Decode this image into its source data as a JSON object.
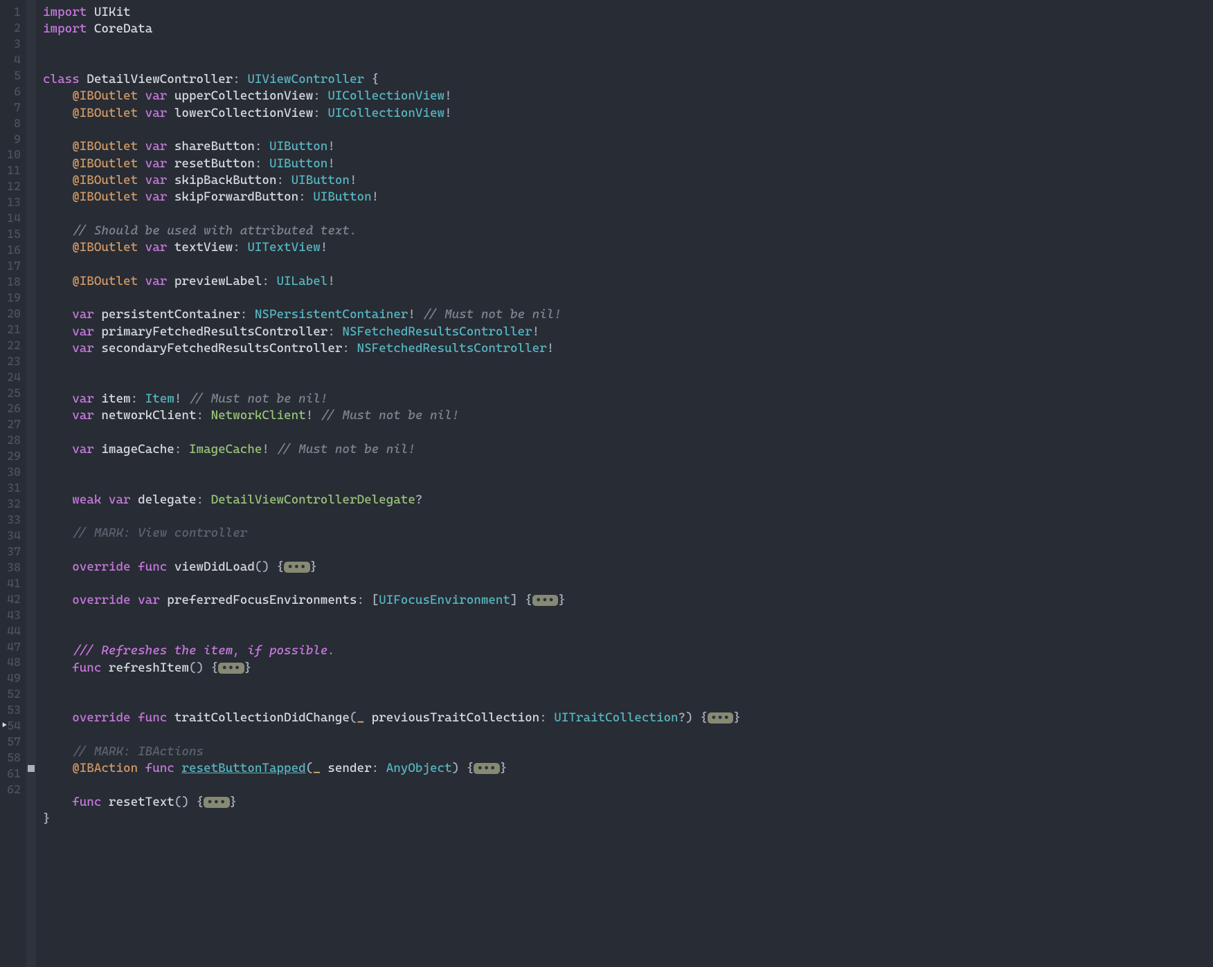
{
  "editor": {
    "lines": [
      {
        "num": "1",
        "html": "<span class='kw'>import</span> <span class='ident'>UIKit</span>"
      },
      {
        "num": "2",
        "html": "<span class='kw'>import</span> <span class='ident'>CoreData</span>"
      },
      {
        "num": "3",
        "html": ""
      },
      {
        "num": "4",
        "html": ""
      },
      {
        "num": "5",
        "html": "<span class='kw'>class</span> <span class='ident'>DetailViewController</span><span class='punc'>:</span> <span class='type'>UIViewController</span> <span class='punc'>{</span>"
      },
      {
        "num": "6",
        "html": "    <span class='attr'>@IBOutlet</span> <span class='kw'>var</span> <span class='ident'>upperCollectionView</span><span class='punc'>:</span> <span class='type'>UICollectionView</span><span class='punc'>!</span>"
      },
      {
        "num": "7",
        "html": "    <span class='attr'>@IBOutlet</span> <span class='kw'>var</span> <span class='ident'>lowerCollectionView</span><span class='punc'>:</span> <span class='type'>UICollectionView</span><span class='punc'>!</span>"
      },
      {
        "num": "8",
        "html": ""
      },
      {
        "num": "9",
        "html": "    <span class='attr'>@IBOutlet</span> <span class='kw'>var</span> <span class='ident'>shareButton</span><span class='punc'>:</span> <span class='type'>UIButton</span><span class='punc'>!</span>"
      },
      {
        "num": "10",
        "html": "    <span class='attr'>@IBOutlet</span> <span class='kw'>var</span> <span class='ident'>resetButton</span><span class='punc'>:</span> <span class='type'>UIButton</span><span class='punc'>!</span>"
      },
      {
        "num": "11",
        "html": "    <span class='attr'>@IBOutlet</span> <span class='kw'>var</span> <span class='ident'>skipBackButton</span><span class='punc'>:</span> <span class='type'>UIButton</span><span class='punc'>!</span>"
      },
      {
        "num": "12",
        "html": "    <span class='attr'>@IBOutlet</span> <span class='kw'>var</span> <span class='ident'>skipForwardButton</span><span class='punc'>:</span> <span class='type'>UIButton</span><span class='punc'>!</span>"
      },
      {
        "num": "13",
        "html": ""
      },
      {
        "num": "14",
        "html": "    <span class='cmt'>// Should be used with attributed text.</span>"
      },
      {
        "num": "15",
        "html": "    <span class='attr'>@IBOutlet</span> <span class='kw'>var</span> <span class='ident'>textView</span><span class='punc'>:</span> <span class='type'>UITextView</span><span class='punc'>!</span>"
      },
      {
        "num": "16",
        "html": ""
      },
      {
        "num": "17",
        "html": "    <span class='attr'>@IBOutlet</span> <span class='kw'>var</span> <span class='ident'>previewLabel</span><span class='punc'>:</span> <span class='type'>UILabel</span><span class='punc'>!</span>"
      },
      {
        "num": "18",
        "html": ""
      },
      {
        "num": "19",
        "html": "    <span class='kw'>var</span> <span class='ident'>persistentContainer</span><span class='punc'>:</span> <span class='type'>NSPersistentContainer</span><span class='punc'>!</span> <span class='cmt'>// Must not be nil!</span>"
      },
      {
        "num": "20",
        "html": "    <span class='kw'>var</span> <span class='ident'>primaryFetchedResultsController</span><span class='punc'>:</span> <span class='type'>NSFetchedResultsController</span><span class='punc'>!</span>"
      },
      {
        "num": "21",
        "html": "    <span class='kw'>var</span> <span class='ident'>secondaryFetchedResultsController</span><span class='punc'>:</span> <span class='type'>NSFetchedResultsController</span><span class='punc'>!</span>"
      },
      {
        "num": "22",
        "html": ""
      },
      {
        "num": "23",
        "html": ""
      },
      {
        "num": "24",
        "html": "    <span class='kw'>var</span> <span class='ident'>item</span><span class='punc'>:</span> <span class='type'>Item</span><span class='punc'>!</span> <span class='cmt'>// Must not be nil!</span>"
      },
      {
        "num": "25",
        "html": "    <span class='kw'>var</span> <span class='ident'>networkClient</span><span class='punc'>:</span> <span class='typeG'>NetworkClient</span><span class='punc'>!</span> <span class='cmt'>// Must not be nil!</span>"
      },
      {
        "num": "26",
        "html": ""
      },
      {
        "num": "27",
        "html": "    <span class='kw'>var</span> <span class='ident'>imageCache</span><span class='punc'>:</span> <span class='typeG'>ImageCache</span><span class='punc'>!</span> <span class='cmt'>// Must not be nil!</span>"
      },
      {
        "num": "28",
        "html": ""
      },
      {
        "num": "29",
        "html": ""
      },
      {
        "num": "30",
        "html": "    <span class='kw'>weak</span> <span class='kw'>var</span> <span class='ident'>delegate</span><span class='punc'>:</span> <span class='typeG'>DetailViewControllerDelegate</span><span class='punc'>?</span>"
      },
      {
        "num": "31",
        "html": ""
      },
      {
        "num": "32",
        "html": "    <span class='cmt2'>// MARK: View controller</span>"
      },
      {
        "num": "33",
        "html": ""
      },
      {
        "num": "34",
        "html": "    <span class='kw'>override</span> <span class='kw'>func</span> <span class='ident'>viewDidLoad</span><span class='punc'>() {</span><span class='fold-chip' data-name='fold-chip-icon' data-interactable='true'>&bull;&bull;&bull;</span><span class='punc'>}</span>"
      },
      {
        "num": "37",
        "html": ""
      },
      {
        "num": "38",
        "html": "    <span class='kw'>override</span> <span class='kw'>var</span> <span class='ident'>preferredFocusEnvironments</span><span class='punc'>: [</span><span class='type'>UIFocusEnvironment</span><span class='punc'>] {</span><span class='fold-chip' data-name='fold-chip-icon' data-interactable='true'>&bull;&bull;&bull;</span><span class='punc'>}</span>"
      },
      {
        "num": "41",
        "html": ""
      },
      {
        "num": "42",
        "html": ""
      },
      {
        "num": "43",
        "html": "    <span class='doc'>/// Refreshes the item, if possible.</span>"
      },
      {
        "num": "44",
        "html": "    <span class='kw'>func</span> <span class='ident'>refreshItem</span><span class='punc'>() {</span><span class='fold-chip' data-name='fold-chip-icon' data-interactable='true'>&bull;&bull;&bull;</span><span class='punc'>}</span>"
      },
      {
        "num": "47",
        "html": ""
      },
      {
        "num": "48",
        "html": ""
      },
      {
        "num": "49",
        "html": "    <span class='kw'>override</span> <span class='kw'>func</span> <span class='ident'>traitCollectionDidChange</span><span class='punc'>(</span><span class='eb'>_</span> <span class='ident'>previousTraitCollection</span><span class='punc'>:</span> <span class='type'>UITraitCollection</span><span class='punc'>?) {</span><span class='fold-chip' data-name='fold-chip-icon' data-interactable='true'>&bull;&bull;&bull;</span><span class='punc'>}</span>"
      },
      {
        "num": "52",
        "html": ""
      },
      {
        "num": "53",
        "html": "    <span class='cmt2'>// MARK: IBActions</span>"
      },
      {
        "num": "54",
        "html": "    <span class='attr'>@IBAction</span> <span class='kw'>func</span> <span class='type und'>resetButtonTapped</span><span class='punc'>(</span><span class='eb'>_</span> <span class='ident'>sender</span><span class='punc'>:</span> <span class='type'>AnyObject</span><span class='punc'>) {</span><span class='fold-chip' data-name='fold-chip-icon' data-interactable='true'>&bull;&bull;&bull;</span><span class='punc'>}</span>",
        "cursor": true
      },
      {
        "num": "57",
        "html": ""
      },
      {
        "num": "58",
        "html": "    <span class='kw'>func</span> <span class='ident'>resetText</span><span class='punc'>() {</span><span class='fold-chip' data-name='fold-chip-icon' data-interactable='true'>&bull;&bull;&bull;</span><span class='punc'>}</span>"
      },
      {
        "num": "61",
        "html": "<span class='punc'>}</span>"
      },
      {
        "num": "62",
        "html": ""
      }
    ]
  }
}
